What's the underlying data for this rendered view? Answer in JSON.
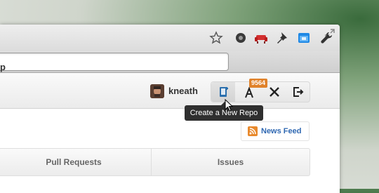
{
  "header": {
    "brand_fragment": "p"
  },
  "user": {
    "username": "kneath"
  },
  "notifications": {
    "count": "9564"
  },
  "tooltip": {
    "text": "Create a New Repo"
  },
  "dashboard": {
    "news_feed_label": "News Feed"
  },
  "tabs": [
    {
      "label": "Pull Requests"
    },
    {
      "label": "Issues"
    }
  ],
  "colors": {
    "accent": "#e0822b",
    "link": "#2e67b1",
    "tooltip_bg": "#2f2f2f"
  },
  "icons": {
    "browser_extensions": [
      "recorder-icon",
      "sofa-icon",
      "pin-icon",
      "window-icon",
      "wrench-icon"
    ],
    "actions": [
      "new-repo-icon",
      "notifications-icon",
      "settings-icon",
      "logout-icon"
    ]
  }
}
